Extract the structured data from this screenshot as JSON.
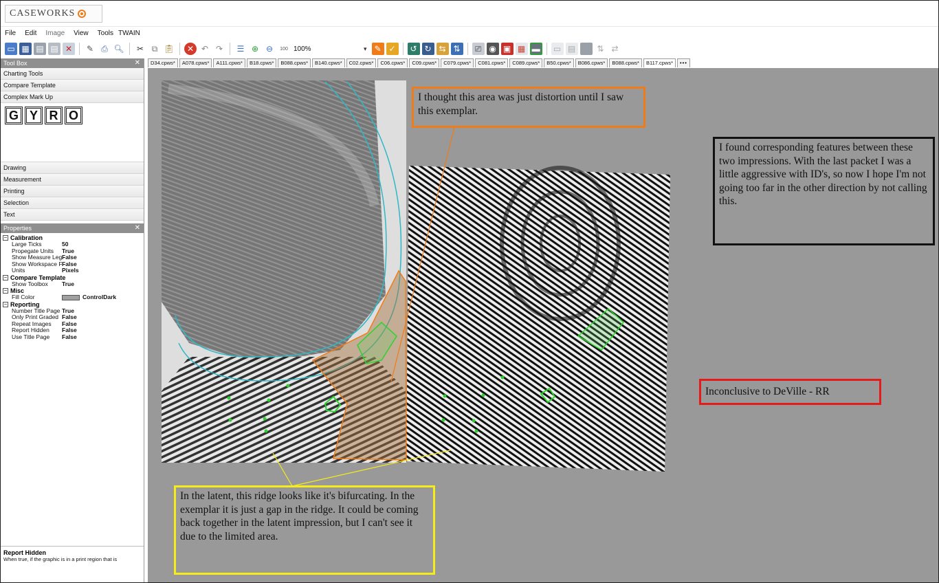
{
  "app": {
    "logo": "CASEWORKS"
  },
  "menu": [
    "File",
    "Edit",
    "Image",
    "View",
    "Tools",
    "TWAIN"
  ],
  "toolbar": {
    "zoom_text": "100%",
    "colors": {
      "accent_orange": "#ef7c18",
      "accent_blue": "#3a6fc2",
      "accent_red": "#d43a2b",
      "accent_green": "#2e9d3c"
    }
  },
  "toolbox": {
    "title": "Tool Box",
    "items_top": [
      "Charting Tools",
      "Compare Template",
      "Complex Mark Up"
    ],
    "gyro": [
      "G",
      "Y",
      "R",
      "O"
    ],
    "items_bottom": [
      "Drawing",
      "Measurement",
      "Printing",
      "Selection",
      "Text"
    ]
  },
  "properties": {
    "title": "Properties",
    "categories": [
      {
        "name": "Calibration",
        "rows": [
          {
            "name": "Large Ticks",
            "value": "50"
          },
          {
            "name": "Propegate Units",
            "value": "True"
          },
          {
            "name": "Show Measure Leg",
            "value": "False"
          },
          {
            "name": "Show Workspace F",
            "value": "False"
          },
          {
            "name": "Units",
            "value": "Pixels"
          }
        ]
      },
      {
        "name": "Compare Template",
        "rows": [
          {
            "name": "Show Toolbox",
            "value": "True"
          }
        ]
      },
      {
        "name": "Misc",
        "rows": [
          {
            "name": "Fill Color",
            "value": "ControlDark"
          }
        ]
      },
      {
        "name": "Reporting",
        "rows": [
          {
            "name": "Number Title Page",
            "value": "True"
          },
          {
            "name": "Only Print Graded",
            "value": "False"
          },
          {
            "name": "Repeat Images",
            "value": "False"
          },
          {
            "name": "Report Hidden",
            "value": "False"
          },
          {
            "name": "Use Title Page",
            "value": "False"
          }
        ]
      }
    ],
    "description_title": "Report Hidden",
    "description_text": "When true, if the graphic is in a print region that is"
  },
  "tabs": [
    "D34.cpws*",
    "A078.cpws*",
    "A111.cpws*",
    "B18.cpws*",
    "B088.cpws*",
    "B140.cpws*",
    "C02.cpws*",
    "C06.cpws*",
    "C09.cpws*",
    "C079.cpws*",
    "C081.cpws*",
    "C089.cpws*",
    "B50.cpws*",
    "B086.cpws*",
    "B088.cpws*",
    "B117.cpws*"
  ],
  "active_tab": "B117.cpws*",
  "more_tabs": "•••",
  "annotations": {
    "orange": "I thought this area was just distortion until I saw this exemplar.",
    "black": "I found corresponding features between these two impressions. With the last packet I was a little aggressive with ID's, so now I hope I'm not going too far in the other direction by not calling this.",
    "red": "Inconclusive to DeVille - RR",
    "yellow": "In the latent, this ridge looks like it's bifurcating.  In the exemplar it is just a gap in the ridge.  It could be coming back together in the latent impression, but I can't see it due to the limited area."
  }
}
